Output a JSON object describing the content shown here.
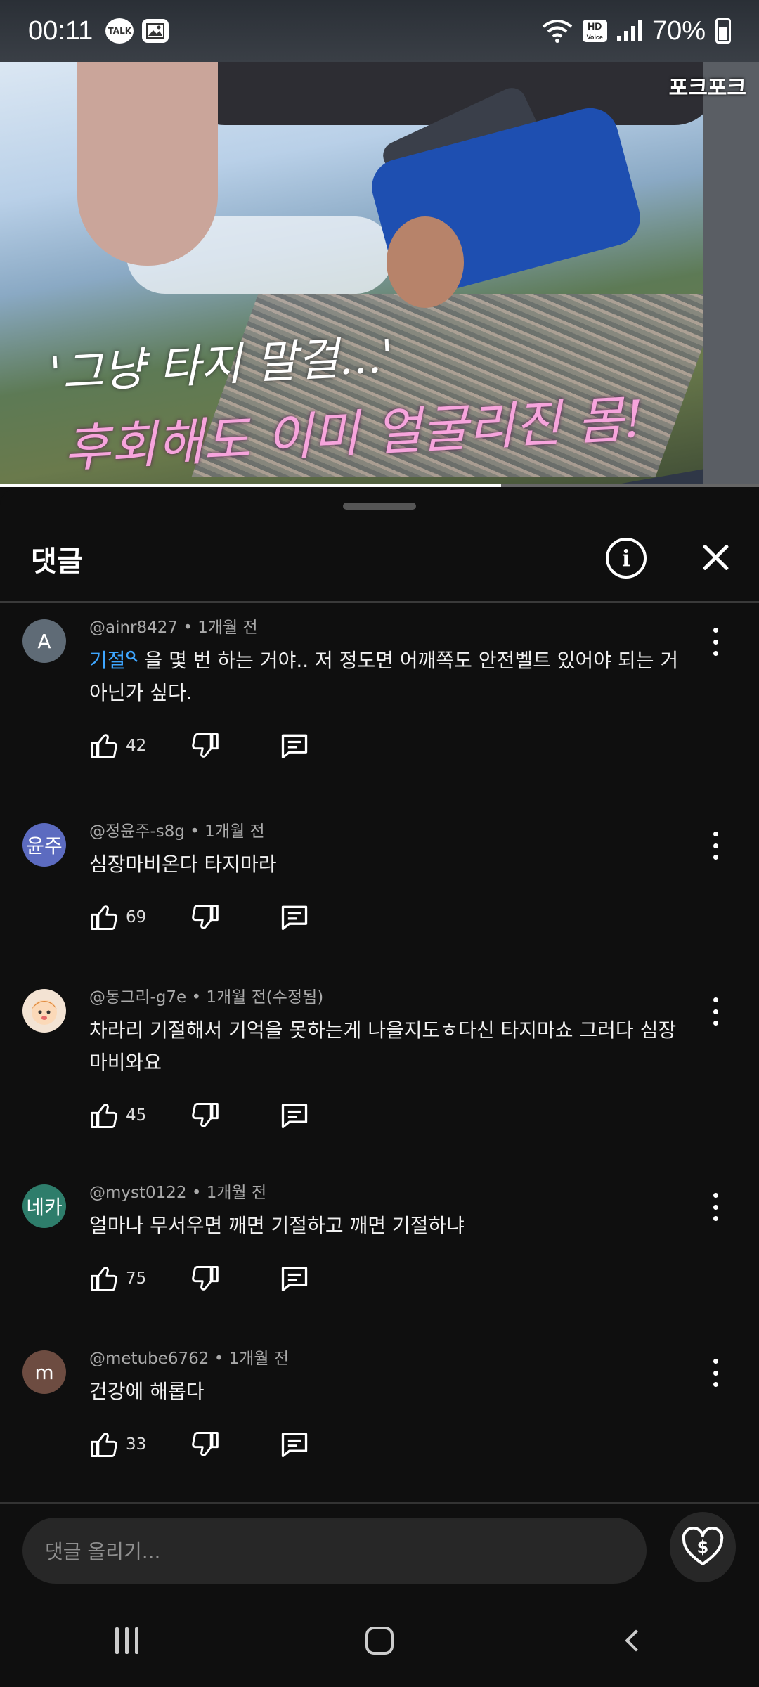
{
  "status_bar": {
    "time": "00:11",
    "talk_icon": "TALK",
    "hd_label": "HD",
    "voice_label": "Voice",
    "battery": "70%"
  },
  "video": {
    "channel": "포크포크",
    "caption_line1": "'그냥 타지 말걸...'",
    "caption_line2": "후회해도 이미 얼굴리진 몸!",
    "progress": 0.66
  },
  "sheet": {
    "title": "댓글",
    "info_symbol": "i"
  },
  "comments": [
    {
      "avatar_text": "A",
      "avatar_color": "#5f6b76",
      "meta": "@ainr8427 • 1개월 전",
      "keyword": "기절",
      "text": " 을 몇 번 하는 거야.. 저 정도면 어깨쪽도 안전벨트 있어야 되는 거 아닌가 싶다.",
      "likes": "42"
    },
    {
      "avatar_text": "윤주",
      "avatar_color": "#5c6bc0",
      "meta": "@정윤주-s8g • 1개월 전",
      "text": "심장마비온다 타지마라",
      "likes": "69"
    },
    {
      "avatar_text": "",
      "avatar_color": "#f3e3d3",
      "meta": "@동그리-g7e • 1개월 전(수정됨)",
      "text": "차라리 기절해서 기억을 못하는게 나을지도ㅎ다신 타지마쇼 그러다 심장마비와요",
      "likes": "45"
    },
    {
      "avatar_text": "네카",
      "avatar_color": "#2e7d6b",
      "meta": "@myst0122 • 1개월 전",
      "text": "얼마나 무서우면 깨면 기절하고 깨면 기절하냐",
      "likes": "75"
    },
    {
      "avatar_text": "m",
      "avatar_color": "#6d4c41",
      "meta": "@metube6762 • 1개월 전",
      "text": "건강에 해롭다",
      "likes": "33"
    }
  ],
  "input": {
    "placeholder": "댓글 올리기..."
  }
}
